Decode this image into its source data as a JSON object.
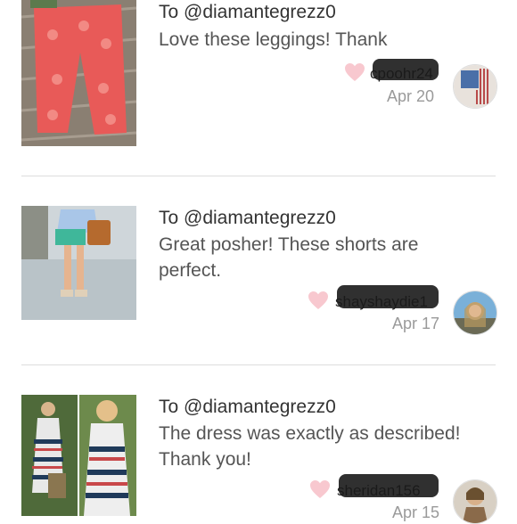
{
  "comments": [
    {
      "to": "To @diamantegrezz0",
      "message": "Love these leggings! Thank",
      "username": "cpoohr24",
      "date": "Apr 20"
    },
    {
      "to": "To @diamantegrezz0",
      "message": "Great posher! These shorts are perfect.",
      "username": "shayshaydie1",
      "date": "Apr 17"
    },
    {
      "to": "To @diamantegrezz0",
      "message": "The dress was exactly as described! Thank you!",
      "username": "sheridan156",
      "date": "Apr 15"
    }
  ],
  "icons": {
    "like": "heart-icon"
  },
  "colors": {
    "heart": "#f8c8cf",
    "divider": "#dddddd",
    "date": "#9a9a9a"
  }
}
